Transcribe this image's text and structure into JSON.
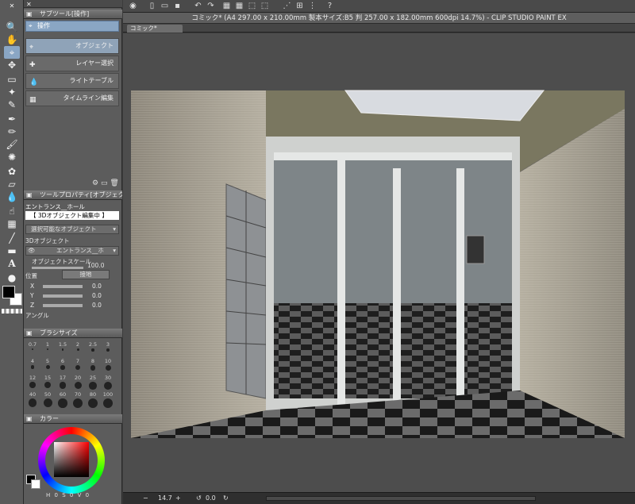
{
  "app": {
    "title": "コミック* (A4 297.00 x 210.00mm 製本サイズ:B5 判 257.00 x 182.00mm 600dpi 14.7%) - CLIP STUDIO PAINT EX"
  },
  "tab": {
    "label": "コミック*"
  },
  "subtool": {
    "title": "サブツール[操作]",
    "group": "操作",
    "items": [
      "オブジェクト",
      "レイヤー選択",
      "ライトテーブル",
      "タイムライン編集"
    ]
  },
  "toolprop": {
    "title": "ツールプロパティ[オブジェクト]",
    "object_name": "エントランス__ホール",
    "mode_label": "【 3Dオブジェクト編集中 】",
    "selectable_label": "選択可能なオブジェクト",
    "section_3d": "3Dオブジェクト",
    "object_entry": "エントランス__ホ",
    "scale_label": "オブジェクトスケール",
    "scale_value": "100.0",
    "position_label": "位置",
    "ground_button": "接地",
    "x_label": "X",
    "x_value": "0.0",
    "y_label": "Y",
    "y_value": "0.0",
    "z_label": "Z",
    "z_value": "0.0",
    "angle_label": "アングル"
  },
  "brushsize": {
    "title": "ブラシサイズ",
    "sizes": [
      "0.7",
      "1",
      "1.5",
      "2",
      "2.5",
      "3",
      "4",
      "5",
      "6",
      "7",
      "8",
      "10",
      "12",
      "15",
      "17",
      "20",
      "25",
      "30",
      "40",
      "50",
      "60",
      "70",
      "80",
      "100"
    ]
  },
  "color": {
    "title": "カラー",
    "readout": [
      "H",
      "0",
      "S",
      "0",
      "V",
      "0"
    ]
  },
  "status": {
    "zoom": "14.7",
    "rotation": "0.0"
  },
  "colors": {
    "accent": "#8aa6c4",
    "panel": "#5c5c5c",
    "main_color": "#000000",
    "sub_color": "#ffffff"
  }
}
